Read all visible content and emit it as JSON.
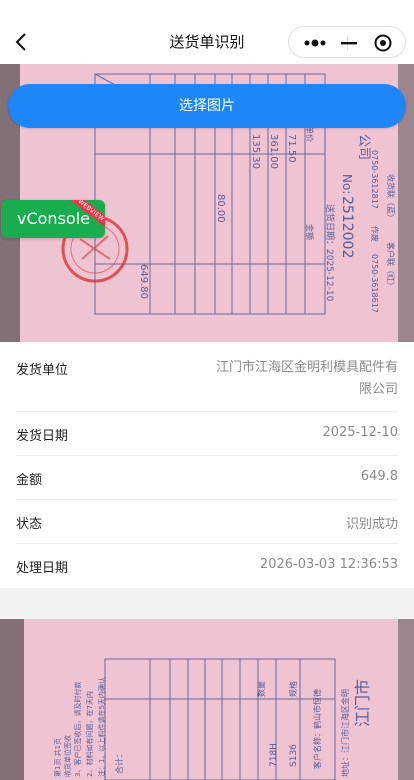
{
  "navbar": {
    "title": "送货单识别",
    "back_icon": "chevron-left-icon",
    "capsule_icons": [
      "more-dots-icon",
      "minimize-icon",
      "close-circle-icon"
    ]
  },
  "pick_button": {
    "label": "选择图片"
  },
  "vconsole": {
    "label": "vConsole",
    "ribbon": "WEBVIEW"
  },
  "result": {
    "rows": [
      {
        "label": "发货单位",
        "value": "江门市江海区金明利模具配件有限公司"
      },
      {
        "label": "发货日期",
        "value": "2025-12-10"
      },
      {
        "label": "金额",
        "value": "649.8"
      },
      {
        "label": "状态",
        "value": "识别成功"
      },
      {
        "label": "处理日期",
        "value": "2026-03-03 12:36:53"
      }
    ]
  },
  "photo_top": {
    "texts": [
      "公司",
      "No:",
      "2512002",
      "送货日期：2025-12-10",
      "收货联（蓝）",
      "客户联（红）",
      "作废",
      "单价",
      "金额",
      "71.50",
      "361.00",
      "135.30",
      "80.00",
      "649.80",
      "0750-3612817",
      "0750-3618617"
    ]
  },
  "photo_bottom": {
    "texts": [
      "江门市",
      "客户名称：鹤山市恒德",
      "地址：江门市江海区金明",
      "规格",
      "数量",
      "S136",
      "718H",
      "合计：",
      "注：1、以上料件请在5天内确认",
      "2、材料如有问题，在7天内",
      "3、客户已签收后，请及时付款",
      "第1页 共1页",
      "收货单位签收"
    ],
    "colors": {
      "paper": "#efc4d2",
      "ink": "#3b4a8c",
      "stamp": "#d8343b"
    }
  }
}
